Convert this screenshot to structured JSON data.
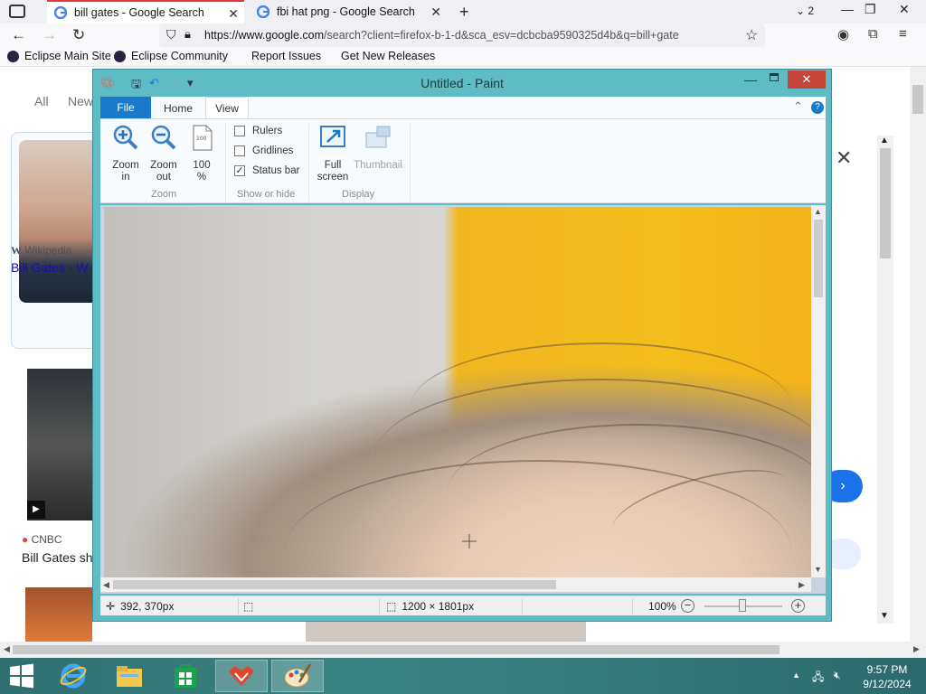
{
  "browser": {
    "tabs": [
      {
        "title": "bill gates - Google Search",
        "active": true
      },
      {
        "title": "fbi hat png - Google Search",
        "active": false
      }
    ],
    "tab_count": "2",
    "url_host": "https://www.google.com",
    "url_rest": "/search?client=firefox-b-1-d&sca_esv=dcbcba9590325d4b&q=bill+gate",
    "bookmarks": [
      "Eclipse Main Site",
      "Eclipse Community",
      "Report Issues",
      "Get New Releases"
    ]
  },
  "google": {
    "tabs": [
      "All",
      "New"
    ],
    "card1_source": "Wikipedia",
    "card1_title": "Bill Gates - W",
    "card2_source": "CNBC",
    "card2_title": "Bill Gates sh"
  },
  "paint": {
    "title": "Untitled - Paint",
    "ribbon_tabs": {
      "file": "File",
      "home": "Home",
      "view": "View"
    },
    "zoom_group": {
      "label": "Zoom",
      "zoom_in": [
        "Zoom",
        "in"
      ],
      "zoom_out": [
        "Zoom",
        "out"
      ],
      "hundred": [
        "100",
        "%"
      ]
    },
    "show_hide_group": {
      "label": "Show or hide",
      "rulers": {
        "label": "Rulers",
        "checked": false
      },
      "gridlines": {
        "label": "Gridlines",
        "checked": false
      },
      "status_bar": {
        "label": "Status bar",
        "checked": true
      }
    },
    "display_group": {
      "label": "Display",
      "full_screen": [
        "Full",
        "screen"
      ],
      "thumbnail": "Thumbnail"
    },
    "status": {
      "cursor_pos": "392, 370px",
      "image_size": "1200 × 1801px",
      "zoom": "100%"
    }
  },
  "taskbar": {
    "time": "9:57 PM",
    "date": "9/12/2024",
    "apps": [
      "start",
      "internet-explorer",
      "file-explorer",
      "store",
      "firefox-devtools",
      "paint"
    ]
  },
  "colors": {
    "paint_frame": "#5fbcc4",
    "file_tab": "#1979ca",
    "close_button": "#c7463c",
    "taskbar": "#2f6f6f"
  }
}
